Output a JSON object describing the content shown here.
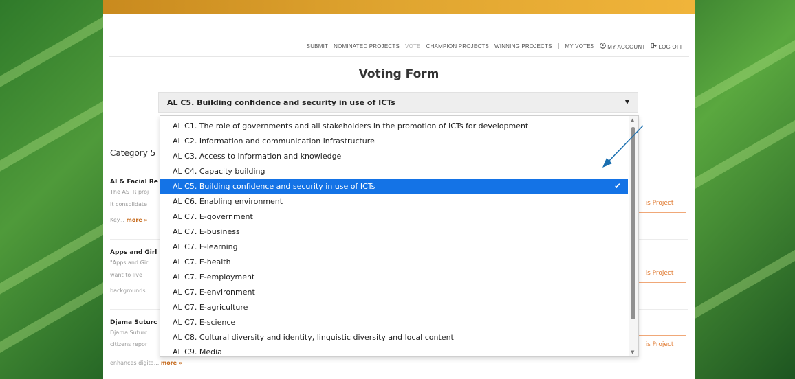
{
  "nav": {
    "items": [
      {
        "label": "SUBMIT"
      },
      {
        "label": "NOMINATED PROJECTS"
      },
      {
        "label": "VOTE"
      },
      {
        "label": "CHAMPION PROJECTS"
      },
      {
        "label": "WINNING PROJECTS"
      },
      {
        "label": "MY VOTES"
      },
      {
        "label": "MY ACCOUNT"
      },
      {
        "label": "LOG OFF"
      }
    ],
    "separator": "|"
  },
  "page": {
    "title": "Voting Form"
  },
  "category_select": {
    "selected": "AL C5. Building confidence and security in use of ICTs",
    "caret": "▼",
    "options": [
      {
        "label": "AL C1. The role of governments and all stakeholders in the promotion of ICTs for development"
      },
      {
        "label": "AL C2. Information and communication infrastructure"
      },
      {
        "label": "AL C3. Access to information and knowledge"
      },
      {
        "label": "AL C4. Capacity building"
      },
      {
        "label": "AL C5. Building confidence and security in use of ICTs"
      },
      {
        "label": "AL C6. Enabling environment"
      },
      {
        "label": "AL C7. E-government"
      },
      {
        "label": "AL C7. E-business"
      },
      {
        "label": "AL C7. E-learning"
      },
      {
        "label": "AL C7. E-health"
      },
      {
        "label": "AL C7. E-employment"
      },
      {
        "label": "AL C7. E-environment"
      },
      {
        "label": "AL C7. E-agriculture"
      },
      {
        "label": "AL C7. E-science"
      },
      {
        "label": "AL C8. Cultural diversity and identity, linguistic diversity and local content"
      },
      {
        "label": "AL C9. Media"
      }
    ],
    "check": "✔"
  },
  "category": {
    "heading_visible": "Category 5"
  },
  "projects": [
    {
      "title": "AI & Facial Re",
      "lines": [
        "The ASTR proj",
        "It consolidate"
      ],
      "tail": "Key...",
      "more": "more »",
      "vote_label": "is Project"
    },
    {
      "title": "Apps and Girl",
      "lines": [
        "\"Apps and Gir",
        "want to live",
        "backgrounds,"
      ],
      "vote_label": "is Project"
    },
    {
      "title": "Djama Suturc",
      "lines": [
        "Djama Suturc",
        "citizens repor"
      ],
      "tail": "enhances digita...",
      "more": "more »",
      "vote_label": "is Project"
    }
  ],
  "colors": {
    "accent_selected": "#1473e6",
    "gold_bar": "#e0a530",
    "vote_button": "#e07a30",
    "arrow": "#1a6fb0"
  }
}
